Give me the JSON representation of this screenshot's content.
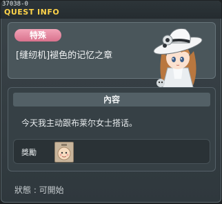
{
  "window": {
    "quest_id": "37038-0",
    "title": "QUEST INFO"
  },
  "header": {
    "category_badge": "特殊",
    "quest_name": "[缝纫机]褪色的记忆之章"
  },
  "content": {
    "section_title": "內容",
    "description": "今天我主动跟布莱尔女士搭话。",
    "reward_label": "獎勵",
    "reward_icon": "doll-face-icon"
  },
  "status": {
    "text": "狀態 : 可開始"
  }
}
